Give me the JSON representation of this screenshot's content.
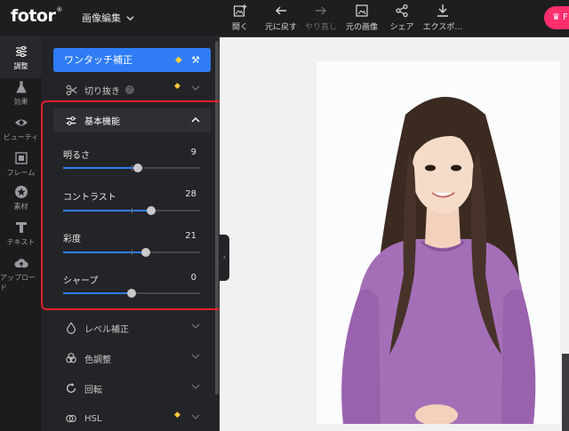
{
  "topbar": {
    "logo": "fotor",
    "logo_reg": "®",
    "mode": "画像編集",
    "tools": [
      {
        "label": "開く",
        "icon": "open-image-icon"
      },
      {
        "label": "元に戻す",
        "icon": "undo-icon"
      },
      {
        "label": "やり直し",
        "icon": "redo-icon"
      },
      {
        "label": "元の画像",
        "icon": "original-image-icon"
      },
      {
        "label": "シェア",
        "icon": "share-icon"
      },
      {
        "label": "エクスポ…",
        "icon": "download-icon"
      }
    ],
    "pro_label": "F"
  },
  "rail": [
    {
      "label": "調整",
      "icon": "adjust-sliders-icon"
    },
    {
      "label": "効果",
      "icon": "flask-icon"
    },
    {
      "label": "ビューティ",
      "icon": "eye-icon"
    },
    {
      "label": "フレーム",
      "icon": "frame-icon"
    },
    {
      "label": "素材",
      "icon": "star-sticker-icon"
    },
    {
      "label": "テキスト",
      "icon": "text-icon"
    },
    {
      "label": "アップロード",
      "icon": "cloud-upload-icon"
    }
  ],
  "panel": {
    "oneclick_label": "ワンタッチ補正",
    "crop_label": "切り抜き",
    "basic_label": "基本機能",
    "sliders": [
      {
        "label": "明るさ",
        "value": "9",
        "level": 9
      },
      {
        "label": "コントラスト",
        "value": "28",
        "level": 28
      },
      {
        "label": "彩度",
        "value": "21",
        "level": 21
      },
      {
        "label": "シャープ",
        "value": "0",
        "level": 0
      }
    ],
    "sections": [
      {
        "label": "レベル補正",
        "icon": "droplet-icon"
      },
      {
        "label": "色調整",
        "icon": "color-circles-icon"
      },
      {
        "label": "回転",
        "icon": "rotate-icon"
      },
      {
        "label": "HSL",
        "icon": "hsl-icon"
      }
    ]
  },
  "colors": {
    "accent": "#2f7cf6",
    "highlight_box": "#e41f2d",
    "premium": "#ffcc3a",
    "pro_button": "#ff2e6d",
    "blouse": "#a56fb7"
  }
}
